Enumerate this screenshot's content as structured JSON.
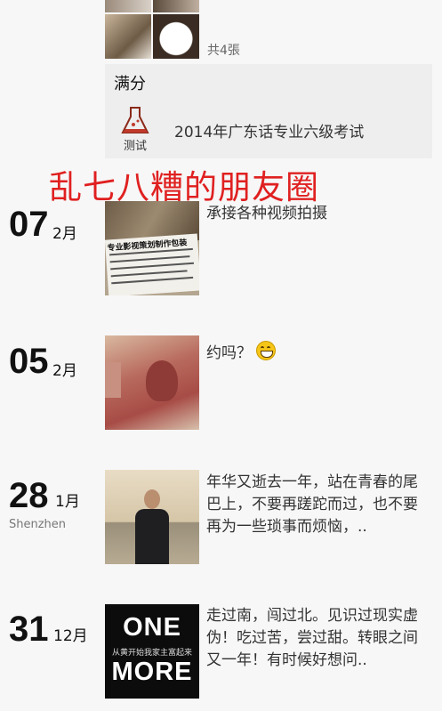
{
  "top_entry": {
    "photo_count": "共4張"
  },
  "share_card": {
    "title": "满分",
    "icon_label": "测试",
    "text": "2014年广东话专业六级考试"
  },
  "overlay_caption": "乱七八糟的朋友圈",
  "posts": [
    {
      "day": "07",
      "month": "2月",
      "location": "",
      "text": "承接各种视频拍摄"
    },
    {
      "day": "05",
      "month": "2月",
      "location": "",
      "text": "约吗？"
    },
    {
      "day": "28",
      "month": "1月",
      "location": "Shenzhen",
      "text": "年华又逝去一年，站在青春的尾巴上，不要再蹉跎而过，也不要再为一些琐事而烦恼，.."
    },
    {
      "day": "31",
      "month": "12月",
      "location": "",
      "text": "走过南，闯过北。见识过现实虚伪！吃过苦，尝过甜。转眼之间又一年！有时候好想问.."
    }
  ],
  "images": {
    "sign_text": "专业影视策划制作包装",
    "one_more_line1": "ONE",
    "one_more_line2": "MORE",
    "one_more_sub": "从黄开始我家主富起来"
  },
  "colors": {
    "caption_red": "#e02020",
    "card_bg": "#eeeeee",
    "page_bg": "#f7f7f7"
  }
}
